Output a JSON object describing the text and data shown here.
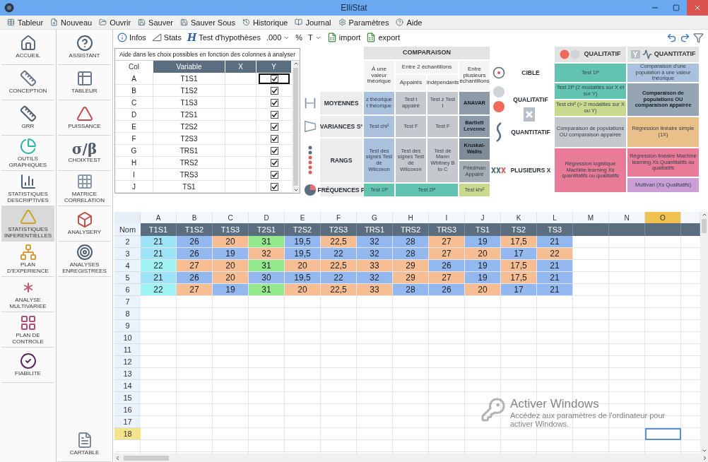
{
  "window": {
    "title": "ElliStat"
  },
  "menu": [
    {
      "label": "Tableur"
    },
    {
      "label": "Nouveau"
    },
    {
      "label": "Ouvrir"
    },
    {
      "label": "Sauver"
    },
    {
      "label": "Sauver Sous"
    },
    {
      "label": "Historique"
    },
    {
      "label": "Journal"
    },
    {
      "label": "Paramètres"
    },
    {
      "label": "Aide"
    }
  ],
  "toolbar": [
    {
      "label": "Infos",
      "dropdown": false
    },
    {
      "label": "Stats",
      "dropdown": false
    },
    {
      "label": "Test d'hypothèses",
      "glyph": "H",
      "dropdown": false
    },
    {
      "label": ".000",
      "dropdown": true
    },
    {
      "label": "%",
      "dropdown": false
    },
    {
      "label": "T",
      "dropdown": true
    },
    {
      "label": "import",
      "dropdown": false
    },
    {
      "label": "export",
      "dropdown": false
    }
  ],
  "sidebar": {
    "column_1": [
      {
        "label": "ACCUEIL",
        "selected": false
      },
      {
        "label": "CONCEPTION",
        "selected": false
      },
      {
        "label": "GRR",
        "selected": false
      },
      {
        "label": "OUTILS GRAPHIQUES",
        "selected": false
      },
      {
        "label": "STATISTIQUES DESCRIPTIVES",
        "selected": false
      },
      {
        "label": "STATISTIQUES INFERENTIELLES",
        "selected": true
      },
      {
        "label": "PLAN D'EXPERIENCE",
        "selected": false
      },
      {
        "label": "ANALYSE MULTIVARIEE",
        "selected": false
      },
      {
        "label": "PLAN DE CONTROLE",
        "selected": false
      },
      {
        "label": "FIABILITE",
        "selected": false
      }
    ],
    "column_2": [
      {
        "label": "ASSISTANT",
        "selected": false
      },
      {
        "label": "TABLEUR",
        "selected": false
      },
      {
        "label": "PUISSANCE",
        "selected": false
      },
      {
        "label": "CHOIXTEST",
        "glyph": "σ/β",
        "selected": false
      },
      {
        "label": "MATRICE CORRELATION",
        "selected": false
      },
      {
        "label": "ANALYSERY",
        "selected": false
      },
      {
        "label": "ANALYSES ENREGISTREES",
        "selected": false
      }
    ],
    "column_2_footer": [
      {
        "label": "CARTABLE",
        "selected": false
      }
    ]
  },
  "help_panel": {
    "title": "Aide dans les choix possibles en fonction des colonnes à analyser",
    "columns": [
      "Col",
      "Variable",
      "X",
      "Y"
    ],
    "rows": [
      {
        "col": "A",
        "variable": "T1S1",
        "y": true,
        "focused": true
      },
      {
        "col": "B",
        "variable": "T1S2",
        "y": true,
        "focused": false
      },
      {
        "col": "C",
        "variable": "T1S3",
        "y": true,
        "focused": false
      },
      {
        "col": "D",
        "variable": "T2S1",
        "y": true,
        "focused": false
      },
      {
        "col": "E",
        "variable": "T2S2",
        "y": true,
        "focused": false
      },
      {
        "col": "F",
        "variable": "T2S3",
        "y": true,
        "focused": false
      },
      {
        "col": "G",
        "variable": "TRS1",
        "y": true,
        "focused": false
      },
      {
        "col": "H",
        "variable": "TRS2",
        "y": true,
        "focused": false
      },
      {
        "col": "I",
        "variable": "TRS3",
        "y": true,
        "focused": false
      },
      {
        "col": "J",
        "variable": "TS1",
        "y": true,
        "focused": false
      }
    ]
  },
  "comparison": {
    "title": "COMPARAISON",
    "subheaders": [
      "À une valeur théorique",
      "Entre 2 échantillons",
      "Entre plusieurs échantillons",
      "Appairés",
      "Indépendants"
    ],
    "rows": [
      {
        "label": "MOYENNES",
        "cells": [
          {
            "text": "z théorique t théorique",
            "color": "#a9c1dd",
            "emphasis": false
          },
          {
            "text": "Test t appairé",
            "color": "#c5c9ce",
            "emphasis": false
          },
          {
            "text": "Test z Test t",
            "color": "#c5c9ce",
            "emphasis": false
          },
          {
            "text": "ANAVAR",
            "color": "#8d9ba8",
            "emphasis": true
          }
        ]
      },
      {
        "label": "VARIANCES S²",
        "cells": [
          {
            "text": "Test chi²",
            "color": "#a9c1dd",
            "emphasis": false
          },
          {
            "text": "Test F",
            "color": "#c5c9ce",
            "emphasis": false
          },
          {
            "text": "Test F",
            "color": "#c5c9ce",
            "emphasis": false
          },
          {
            "text": "Bartlett Levenne",
            "color": "#8d9ba8",
            "emphasis": true
          }
        ]
      },
      {
        "label": "RANGS",
        "cells": [
          {
            "text": "Test des signes Test de Wilcoxon",
            "color": "#a9c1dd",
            "emphasis": false
          },
          {
            "text": "Test des signes Test de Wilcoxon",
            "color": "#c5c9ce",
            "emphasis": false
          },
          {
            "text": "Test de Mann Whitney B to C",
            "color": "#c5c9ce",
            "emphasis": false
          },
          {
            "split": [
              {
                "text": "Kruskal-Wallis",
                "color": "#7f8d99",
                "emphasis": true
              },
              {
                "text": "Friedman Appairé",
                "color": "#a3adb6",
                "emphasis": false
              }
            ]
          }
        ]
      },
      {
        "label": "FRÉQUENCES P",
        "cells": [
          {
            "text": "Test 1P",
            "color": "#62c3b0",
            "emphasis": false
          },
          {
            "text": "Test 2P",
            "color": "#62c3b0",
            "emphasis": false,
            "colspan": 2
          },
          {
            "text": "Test khi²",
            "color": "#c9da8e",
            "emphasis": false
          }
        ]
      }
    ]
  },
  "variable_types": {
    "headers": [
      {
        "label": "QUALITATIF"
      },
      {
        "label": "QUANTITATIF",
        "badge": "Y"
      }
    ],
    "rows": [
      {
        "label": "CIBLE",
        "cells": [
          {
            "text": "Test 1P",
            "color": "#62c3b0",
            "emphasis": false
          },
          {
            "text": "Comparaison d'une population à une valeur théorique",
            "color": "#a9c1dd",
            "emphasis": false
          }
        ]
      },
      {
        "label": "QUALITATIF",
        "cells": [
          {
            "split": [
              {
                "text": "Test 2P (2 modalités sur X et sur Y)",
                "color": "#62c3b0",
                "emphasis": false
              },
              {
                "text": "Test chi² (> 2 modalités sur X ou Y)",
                "color": "#c9da8e",
                "emphasis": false
              }
            ]
          },
          {
            "text": "Comparaison de populations OU comparaison appairée",
            "color": "#95a5b3",
            "emphasis": true
          }
        ]
      },
      {
        "label": "QUANTITATIF",
        "cells": [
          {
            "text": "Comparaison de populations OU comparaison appairée",
            "color": "#c5c9ce",
            "emphasis": false
          },
          {
            "text": "Régression linéaire simple (1X)",
            "color": "#e9bf8a",
            "emphasis": false
          }
        ]
      },
      {
        "label": "PLUSIEURS X",
        "cells": [
          {
            "text": "Régression logistique Machine learning Xs quantitatifs ou qualitatifs",
            "color": "#e77b98",
            "emphasis": false
          },
          {
            "split": [
              {
                "text": "Régression linéaire Machine learning Xs Quantitatifs ou qualitatifs",
                "color": "#e77b98",
                "emphasis": false
              },
              {
                "text": "Multivari (Xs Qualitatifs)",
                "color": "#c99fd6",
                "emphasis": false
              }
            ]
          }
        ]
      }
    ]
  },
  "sheet": {
    "corner_label": "Nom",
    "columns": [
      {
        "letter": "A",
        "name": "T1S1",
        "selected": false
      },
      {
        "letter": "B",
        "name": "T1S2",
        "selected": false
      },
      {
        "letter": "C",
        "name": "T1S3",
        "selected": false
      },
      {
        "letter": "D",
        "name": "T2S1",
        "selected": false
      },
      {
        "letter": "E",
        "name": "T2S2",
        "selected": false
      },
      {
        "letter": "F",
        "name": "T2S3",
        "selected": false
      },
      {
        "letter": "G",
        "name": "TRS1",
        "selected": false
      },
      {
        "letter": "H",
        "name": "TRS2",
        "selected": false
      },
      {
        "letter": "I",
        "name": "TRS3",
        "selected": false
      },
      {
        "letter": "J",
        "name": "TS1",
        "selected": false
      },
      {
        "letter": "K",
        "name": "TS2",
        "selected": false
      },
      {
        "letter": "L",
        "name": "TS3",
        "selected": false
      },
      {
        "letter": "M",
        "selected": false
      },
      {
        "letter": "N",
        "selected": false
      },
      {
        "letter": "O",
        "selected": true
      }
    ],
    "rows": [
      {
        "label": "2",
        "selected": false,
        "cells": [
          {
            "value": "21",
            "color": "#9fe3f6"
          },
          {
            "value": "26",
            "color": "#93b8f0"
          },
          {
            "value": "20",
            "color": "#f7bd93"
          },
          {
            "value": "31",
            "color": "#93e98c"
          },
          {
            "value": "19,5",
            "color": "#93b8f0"
          },
          {
            "value": "22,5",
            "color": "#f7bd93"
          },
          {
            "value": "32",
            "color": "#93b8f0"
          },
          {
            "value": "28",
            "color": "#93b8f0"
          },
          {
            "value": "27",
            "color": "#f7bd93"
          },
          {
            "value": "19",
            "color": "#93b8f0"
          },
          {
            "value": "17,5",
            "color": "#f7bd93"
          },
          {
            "value": "21",
            "color": "#93b8f0"
          }
        ]
      },
      {
        "label": "3",
        "selected": false,
        "cells": [
          {
            "value": "21",
            "color": "#9fe3f6"
          },
          {
            "value": "26",
            "color": "#93b8f0"
          },
          {
            "value": "19",
            "color": "#93b8f0"
          },
          {
            "value": "32",
            "color": "#f7bd93"
          },
          {
            "value": "19,5",
            "color": "#93b8f0"
          },
          {
            "value": "22",
            "color": "#93b8f0"
          },
          {
            "value": "32",
            "color": "#93b8f0"
          },
          {
            "value": "28",
            "color": "#93b8f0"
          },
          {
            "value": "27",
            "color": "#f7bd93"
          },
          {
            "value": "20",
            "color": "#f7bd93"
          },
          {
            "value": "17",
            "color": "#93b8f0"
          },
          {
            "value": "22",
            "color": "#f7bd93"
          }
        ]
      },
      {
        "label": "4",
        "selected": false,
        "cells": [
          {
            "value": "22",
            "color": "#9ff3f3"
          },
          {
            "value": "27",
            "color": "#f7bd93"
          },
          {
            "value": "20",
            "color": "#f7bd93"
          },
          {
            "value": "31",
            "color": "#93e98c"
          },
          {
            "value": "20",
            "color": "#f7bd93"
          },
          {
            "value": "22,5",
            "color": "#f7bd93"
          },
          {
            "value": "33",
            "color": "#f7bd93"
          },
          {
            "value": "29",
            "color": "#f7bd93"
          },
          {
            "value": "26",
            "color": "#93b8f0"
          },
          {
            "value": "19",
            "color": "#93b8f0"
          },
          {
            "value": "17,5",
            "color": "#f7bd93"
          },
          {
            "value": "21",
            "color": "#93b8f0"
          }
        ]
      },
      {
        "label": "5",
        "selected": false,
        "cells": [
          {
            "value": "21",
            "color": "#9fe3f6"
          },
          {
            "value": "26",
            "color": "#93b8f0"
          },
          {
            "value": "20",
            "color": "#f7bd93"
          },
          {
            "value": "30",
            "color": "#93b8f0"
          },
          {
            "value": "19,5",
            "color": "#93b8f0"
          },
          {
            "value": "22",
            "color": "#93b8f0"
          },
          {
            "value": "32",
            "color": "#93b8f0"
          },
          {
            "value": "29",
            "color": "#f7bd93"
          },
          {
            "value": "27",
            "color": "#f7bd93"
          },
          {
            "value": "19",
            "color": "#93b8f0"
          },
          {
            "value": "17,5",
            "color": "#f7bd93"
          },
          {
            "value": "21",
            "color": "#93b8f0"
          }
        ]
      },
      {
        "label": "6",
        "selected": false,
        "cells": [
          {
            "value": "22",
            "color": "#9ff3f3"
          },
          {
            "value": "27",
            "color": "#f7bd93"
          },
          {
            "value": "19",
            "color": "#93b8f0"
          },
          {
            "value": "31",
            "color": "#93e98c"
          },
          {
            "value": "20",
            "color": "#f7bd93"
          },
          {
            "value": "22,5",
            "color": "#f7bd93"
          },
          {
            "value": "33",
            "color": "#f7bd93"
          },
          {
            "value": "28",
            "color": "#93b8f0"
          },
          {
            "value": "26",
            "color": "#93b8f0"
          },
          {
            "value": "20",
            "color": "#f7bd93"
          },
          {
            "value": "17",
            "color": "#93b8f0"
          },
          {
            "value": "21",
            "color": "#93b8f0"
          }
        ]
      },
      {
        "label": "7",
        "selected": false
      },
      {
        "label": "8",
        "selected": false
      },
      {
        "label": "9",
        "selected": false
      },
      {
        "label": "10",
        "selected": false
      },
      {
        "label": "11",
        "selected": false
      },
      {
        "label": "12",
        "selected": false
      },
      {
        "label": "13",
        "selected": false
      },
      {
        "label": "14",
        "selected": false
      },
      {
        "label": "15",
        "selected": false
      },
      {
        "label": "16",
        "selected": false
      },
      {
        "label": "17",
        "selected": false
      },
      {
        "label": "18",
        "selected": true
      }
    ]
  },
  "activation_notice": {
    "title": "Activer Windows",
    "text": "Accédez aux paramètres de l'ordinateur pour activer Windows."
  }
}
